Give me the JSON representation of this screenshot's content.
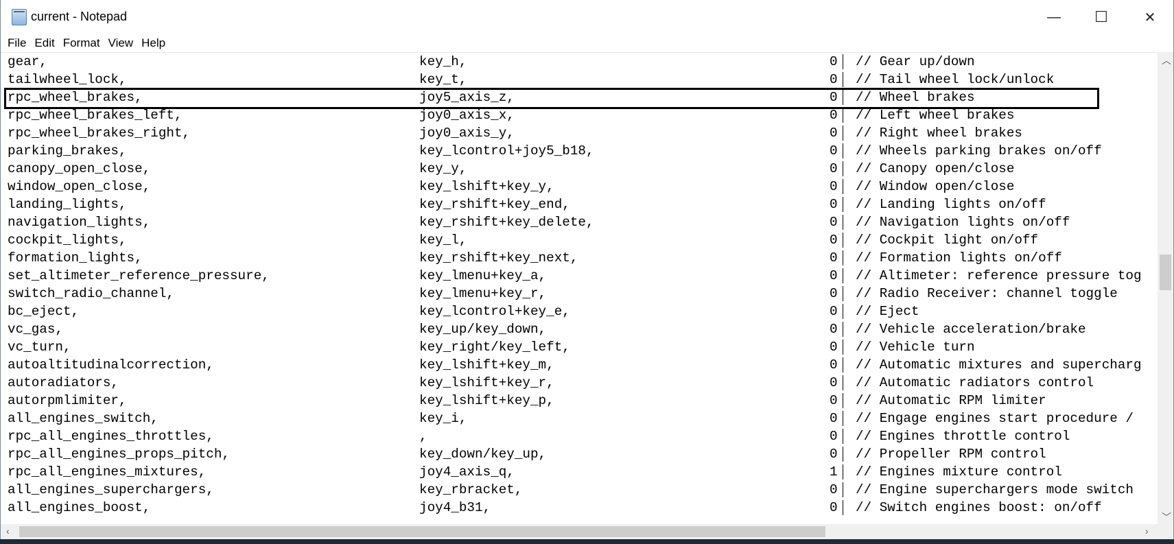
{
  "window": {
    "title": "current - Notepad",
    "controls": {
      "minimize": "—",
      "maximize": "☐",
      "close": "✕"
    }
  },
  "menu": [
    "File",
    "Edit",
    "Format",
    "View",
    "Help"
  ],
  "highlighted_row": 2,
  "rows": [
    {
      "action": "gear,",
      "key": "key_h,",
      "flag": "0",
      "comment": "// Gear up/down"
    },
    {
      "action": "tailwheel_lock,",
      "key": "key_t,",
      "flag": "0",
      "comment": "// Tail wheel lock/unlock"
    },
    {
      "action": "rpc_wheel_brakes,",
      "key": "joy5_axis_z,",
      "flag": "0",
      "comment": "// Wheel brakes"
    },
    {
      "action": "rpc_wheel_brakes_left,",
      "key": "joy0_axis_x,",
      "flag": "0",
      "comment": "// Left wheel brakes"
    },
    {
      "action": "rpc_wheel_brakes_right,",
      "key": "joy0_axis_y,",
      "flag": "0",
      "comment": "// Right wheel brakes"
    },
    {
      "action": "parking_brakes,",
      "key": "key_lcontrol+joy5_b18,",
      "flag": "0",
      "comment": "// Wheels parking brakes on/off"
    },
    {
      "action": "canopy_open_close,",
      "key": "key_y,",
      "flag": "0",
      "comment": "// Canopy open/close"
    },
    {
      "action": "window_open_close,",
      "key": "key_lshift+key_y,",
      "flag": "0",
      "comment": "// Window open/close"
    },
    {
      "action": "landing_lights,",
      "key": "key_rshift+key_end,",
      "flag": "0",
      "comment": "// Landing lights on/off"
    },
    {
      "action": "navigation_lights,",
      "key": "key_rshift+key_delete,",
      "flag": "0",
      "comment": "// Navigation lights on/off"
    },
    {
      "action": "cockpit_lights,",
      "key": "key_l,",
      "flag": "0",
      "comment": "// Cockpit light on/off"
    },
    {
      "action": "formation_lights,",
      "key": "key_rshift+key_next,",
      "flag": "0",
      "comment": "// Formation lights on/off"
    },
    {
      "action": "set_altimeter_reference_pressure,",
      "key": "key_lmenu+key_a,",
      "flag": "0",
      "comment": "// Altimeter: reference pressure tog"
    },
    {
      "action": "switch_radio_channel,",
      "key": "key_lmenu+key_r,",
      "flag": "0",
      "comment": "// Radio Receiver: channel toggle"
    },
    {
      "action": "bc_eject,",
      "key": "key_lcontrol+key_e,",
      "flag": "0",
      "comment": "// Eject"
    },
    {
      "action": "vc_gas,",
      "key": "key_up/key_down,",
      "flag": "0",
      "comment": "// Vehicle acceleration/brake"
    },
    {
      "action": "vc_turn,",
      "key": "key_right/key_left,",
      "flag": "0",
      "comment": "// Vehicle turn"
    },
    {
      "action": "autoaltitudinalcorrection,",
      "key": "key_lshift+key_m,",
      "flag": "0",
      "comment": "// Automatic mixtures and supercharg"
    },
    {
      "action": "autoradiators,",
      "key": "key_lshift+key_r,",
      "flag": "0",
      "comment": "// Automatic radiators control"
    },
    {
      "action": "autorpmlimiter,",
      "key": "key_lshift+key_p,",
      "flag": "0",
      "comment": "// Automatic RPM limiter"
    },
    {
      "action": "all_engines_switch,",
      "key": "key_i,",
      "flag": "0",
      "comment": "// Engage engines start procedure / "
    },
    {
      "action": "rpc_all_engines_throttles,",
      "key": ",",
      "flag": "0",
      "comment": "// Engines throttle control"
    },
    {
      "action": "rpc_all_engines_props_pitch,",
      "key": "key_down/key_up,",
      "flag": "0",
      "comment": "// Propeller RPM control"
    },
    {
      "action": "rpc_all_engines_mixtures,",
      "key": "joy4_axis_q,",
      "flag": "1",
      "comment": "// Engines mixture control"
    },
    {
      "action": "all_engines_superchargers,",
      "key": "key_rbracket,",
      "flag": "0",
      "comment": "// Engine superchargers mode switch"
    },
    {
      "action": "all_engines_boost,",
      "key": "joy4_b31,",
      "flag": "0",
      "comment": "// Switch engines boost: on/off"
    }
  ]
}
